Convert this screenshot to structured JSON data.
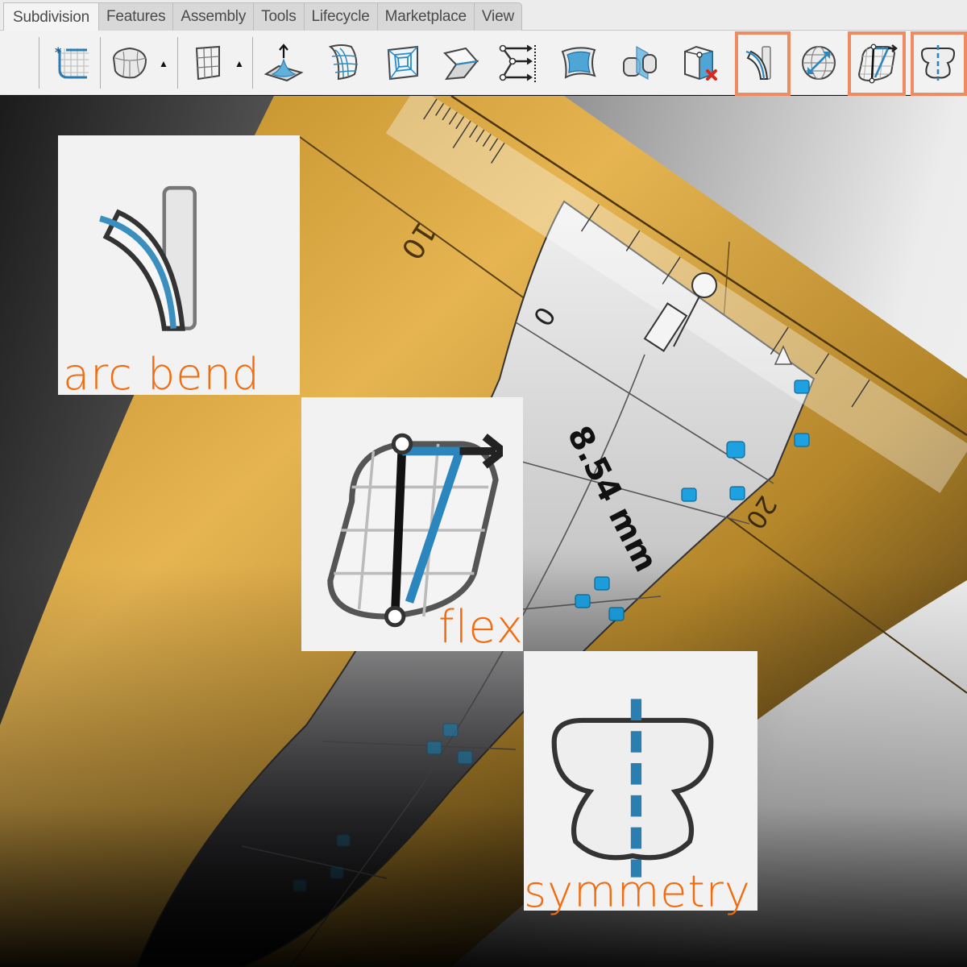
{
  "tabs": [
    {
      "label": "Subdivision",
      "active": true
    },
    {
      "label": "Features",
      "active": false
    },
    {
      "label": "Assembly",
      "active": false
    },
    {
      "label": "Tools",
      "active": false
    },
    {
      "label": "Lifecycle",
      "active": false
    },
    {
      "label": "Marketplace",
      "active": false
    },
    {
      "label": "View",
      "active": false
    }
  ],
  "toolbar": {
    "icons": [
      {
        "name": "create-subdivision-icon"
      },
      {
        "name": "primitive-box-icon",
        "has_dropdown": true
      },
      {
        "name": "plane-grid-icon",
        "has_dropdown": true
      },
      {
        "name": "extrude-pull-icon"
      },
      {
        "name": "curved-face-grid-icon"
      },
      {
        "name": "inset-face-icon"
      },
      {
        "name": "fold-face-icon"
      },
      {
        "name": "bridge-edges-icon"
      },
      {
        "name": "fill-face-icon"
      },
      {
        "name": "split-body-icon"
      },
      {
        "name": "delete-vertex-icon"
      },
      {
        "name": "arc-bend-icon",
        "highlighted": true
      },
      {
        "name": "sphere-scale-icon"
      },
      {
        "name": "flex-icon",
        "highlighted": true
      },
      {
        "name": "symmetry-icon",
        "highlighted": true
      }
    ],
    "highlight_color": "#f08a62"
  },
  "viewport": {
    "ruler_labels": [
      "10",
      "0",
      "20"
    ],
    "dimension_readout": "8.54 mm",
    "colors": {
      "ground_plane": "#c9952e",
      "control_point": "#1da1e0",
      "model_surface": "#d9d9d9"
    }
  },
  "callouts": [
    {
      "id": "arc-bend",
      "label": "arc bend"
    },
    {
      "id": "flex",
      "label": "flex"
    },
    {
      "id": "symmetry",
      "label": "symmetry"
    }
  ],
  "callout_label_color": "#f26b0f"
}
